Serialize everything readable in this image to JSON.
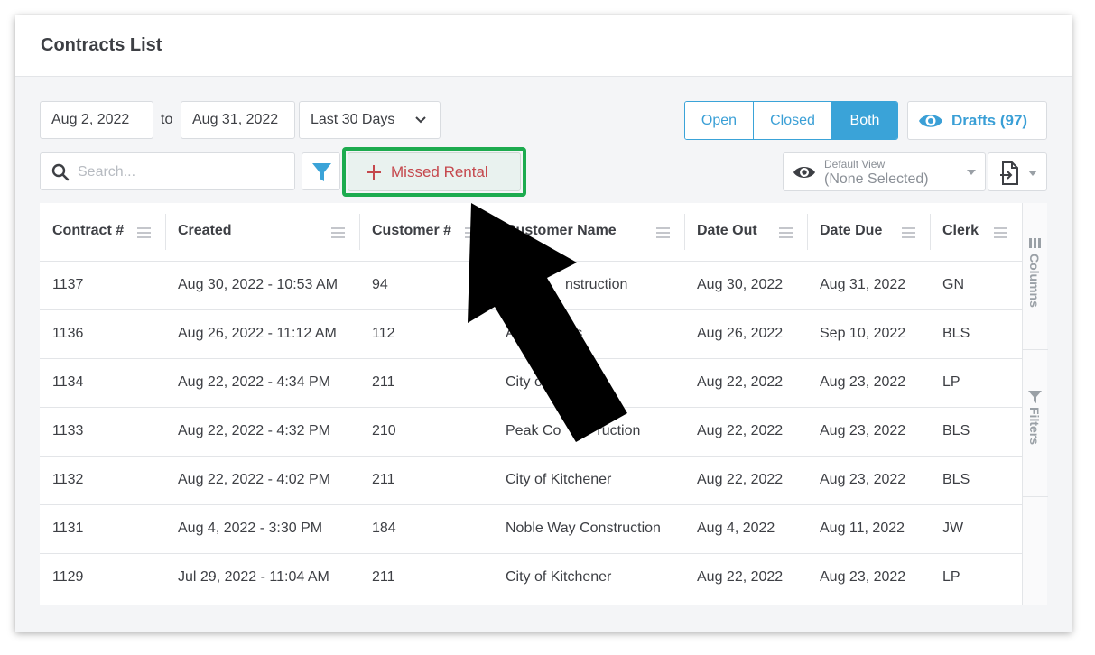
{
  "page": {
    "title": "Contracts List"
  },
  "toolbar": {
    "date_from": "Aug 2, 2022",
    "to_label": "to",
    "date_to": "Aug 31, 2022",
    "range_select": "Last 30 Days",
    "status_tabs": {
      "open": "Open",
      "closed": "Closed",
      "both": "Both",
      "active": "Both"
    },
    "drafts_label": "Drafts (97)",
    "search_placeholder": "Search...",
    "missed_rental_label": "Missed Rental",
    "view_caption": "Default View",
    "view_value": "(None Selected)"
  },
  "table": {
    "columns": [
      "Contract #",
      "Created",
      "Customer #",
      "Customer Name",
      "Date Out",
      "Date Due",
      "Clerk"
    ],
    "rows": [
      [
        "1137",
        "Aug 30, 2022 - 10:53 AM",
        "94",
        "nstruction",
        "Aug 30, 2022",
        "Aug 31, 2022",
        "GN"
      ],
      [
        "1136",
        "Aug 26, 2022 - 11:12 AM",
        "112",
        "A              rs",
        "Aug 26, 2022",
        "Sep 10, 2022",
        "BLS"
      ],
      [
        "1134",
        "Aug 22, 2022 - 4:34 PM",
        "211",
        "City o",
        "Aug 22, 2022",
        "Aug 23, 2022",
        "LP"
      ],
      [
        "1133",
        "Aug 22, 2022 - 4:32 PM",
        "210",
        "Peak Co         ruction",
        "Aug 22, 2022",
        "Aug 23, 2022",
        "BLS"
      ],
      [
        "1132",
        "Aug 22, 2022 - 4:02 PM",
        "211",
        "City of Kitchener",
        "Aug 22, 2022",
        "Aug 23, 2022",
        "BLS"
      ],
      [
        "1131",
        "Aug 4, 2022 - 3:30 PM",
        "184",
        "Noble Way Construction",
        "Aug 4, 2022",
        "Aug 11, 2022",
        "JW"
      ],
      [
        "1129",
        "Jul 29, 2022 - 11:04 AM",
        "211",
        "City of Kitchener",
        "Aug 22, 2022",
        "Aug 23, 2022",
        "LP"
      ]
    ]
  },
  "side_panel": {
    "columns_label": "Columns",
    "filters_label": "Filters"
  },
  "colors": {
    "accent": "#3aa3d8",
    "highlight_outline": "#1dab4f",
    "missed_text": "#c5484d",
    "arrow": "#000000"
  }
}
